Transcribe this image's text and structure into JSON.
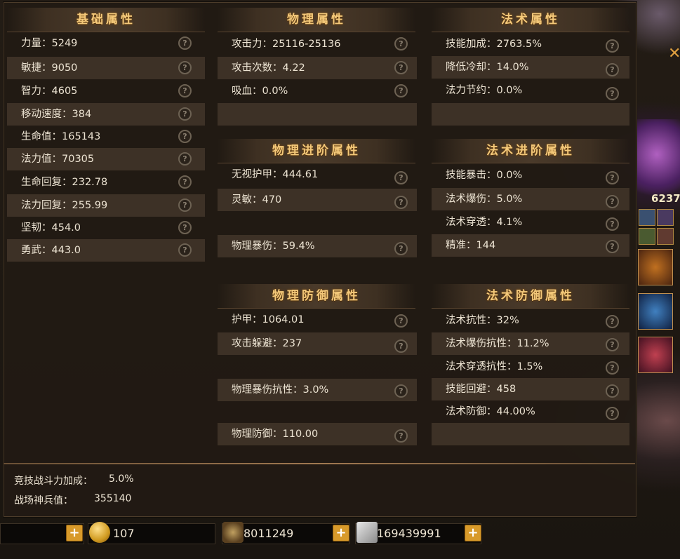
{
  "basic": {
    "title": "基础属性",
    "rows": [
      {
        "label": "力量：5249"
      },
      {
        "label": "敏捷：9050"
      },
      {
        "label": "智力：4605"
      },
      {
        "label": "移动速度：384"
      },
      {
        "label": "生命值：165143"
      },
      {
        "label": "法力值：70305"
      },
      {
        "label": "生命回复：232.78"
      },
      {
        "label": "法力回复：255.99"
      },
      {
        "label": "坚韧：454.0"
      },
      {
        "label": "勇武：443.0"
      }
    ]
  },
  "physical": {
    "title": "物理属性",
    "rows": [
      {
        "label": "攻击力：25116-25136"
      },
      {
        "label": "攻击次数：4.22"
      },
      {
        "label": "吸血：0.0%"
      }
    ]
  },
  "magic": {
    "title": "法术属性",
    "rows": [
      {
        "label": "技能加成：2763.5%"
      },
      {
        "label": "降低冷却：14.0%"
      },
      {
        "label": "法力节约：0.0%"
      }
    ]
  },
  "phys_adv": {
    "title": "物理进阶属性",
    "rows": [
      {
        "label": "无视护甲：444.61"
      },
      {
        "label": "灵敏：470"
      },
      {
        "label": "物理暴伤：59.4%"
      }
    ]
  },
  "magic_adv": {
    "title": "法术进阶属性",
    "rows": [
      {
        "label": "技能暴击：0.0%"
      },
      {
        "label": "法术爆伤：5.0%"
      },
      {
        "label": "法术穿透：4.1%"
      },
      {
        "label": "精准：144"
      }
    ]
  },
  "phys_def": {
    "title": "物理防御属性",
    "rows": [
      {
        "label": "护甲：1064.01"
      },
      {
        "label": "攻击躲避：237"
      },
      {
        "label": "物理暴伤抗性：3.0%"
      },
      {
        "label": "物理防御：110.00"
      }
    ]
  },
  "magic_def": {
    "title": "法术防御属性",
    "rows": [
      {
        "label": "法术抗性：32%"
      },
      {
        "label": "法术爆伤抗性：11.2%"
      },
      {
        "label": "法术穿透抗性：1.5%"
      },
      {
        "label": "技能回避：458"
      },
      {
        "label": "法术防御：44.00%"
      }
    ]
  },
  "help_glyph": "?",
  "footer": {
    "arena_label": "竞技战斗力加成：",
    "arena_value": "5.0%",
    "weapon_label": "战场神兵值：",
    "weapon_value": "355140"
  },
  "currency": {
    "gold": "107",
    "ore": "8011249",
    "money": "169439991",
    "plus": "+"
  },
  "side_number": "6237"
}
